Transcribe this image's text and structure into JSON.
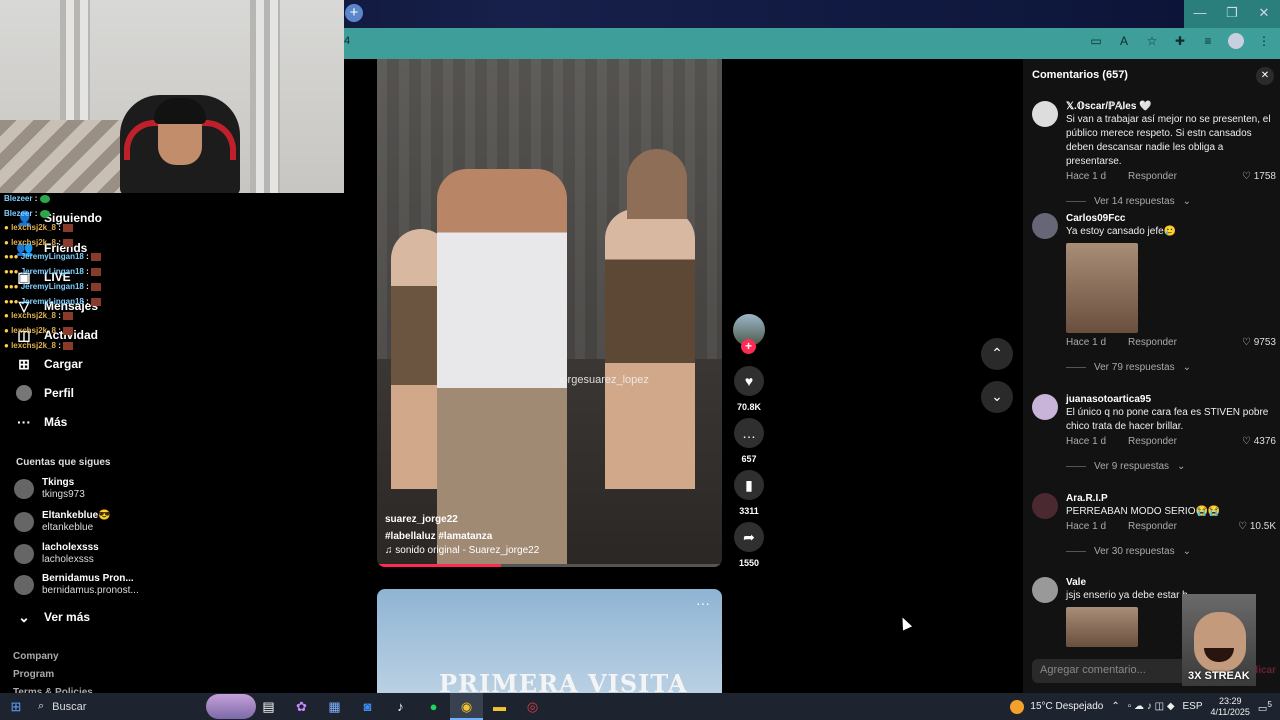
{
  "browser": {
    "url_fragment": "4",
    "new_tab": "+",
    "icons": [
      "screen-cast-icon",
      "translate-icon",
      "star-icon",
      "extensions-icon",
      "media-icon",
      "profile-icon",
      "menu-icon"
    ],
    "window_controls": [
      "—",
      "❐",
      "✕"
    ]
  },
  "chat": [
    {
      "user": "Blezeer",
      "msg": ""
    },
    {
      "user": "Blezeer",
      "msg": ""
    },
    {
      "user": "lexchsj2k_8",
      "msg": ""
    },
    {
      "user": "lexchsj2k_8",
      "msg": ""
    },
    {
      "user": "JeremyLingan18",
      "msg": ""
    },
    {
      "user": "JeremyLingan18",
      "msg": ""
    },
    {
      "user": "JeremyLingan18",
      "msg": ""
    },
    {
      "user": "JeremyLingan18",
      "msg": ""
    },
    {
      "user": "lexchsj2k_8",
      "msg": ""
    },
    {
      "user": "lexchsj2k_8",
      "msg": ""
    },
    {
      "user": "lexchsj2k_8",
      "msg": ""
    }
  ],
  "sidebar": {
    "items": [
      {
        "label": "Siguiendo"
      },
      {
        "label": "Friends"
      },
      {
        "label": "LIVE"
      },
      {
        "label": "Mensajes"
      },
      {
        "label": "Actividad"
      },
      {
        "label": "Cargar"
      },
      {
        "label": "Perfil"
      },
      {
        "label": "Más"
      }
    ],
    "following_title": "Cuentas que sigues",
    "following": [
      {
        "name": "Tkings",
        "handle": "tkings973"
      },
      {
        "name": "Eltankeblue😎",
        "handle": "eltankeblue"
      },
      {
        "name": "lacholexsss",
        "handle": "lacholexsss"
      },
      {
        "name": "Bernidamus Pron...",
        "handle": "bernidamus.pronost..."
      }
    ],
    "see_more": "Ver más",
    "footer": [
      "Company",
      "Program",
      "Terms & Policies"
    ]
  },
  "video": {
    "author": "suarez_jorge22",
    "hashtags": "#labellaluz  #lamatanza",
    "sound": "sonido original - Suarez_jorge22",
    "watermark": "jorgesuarez_lopez",
    "progress": 0.36,
    "likes": "70.8K",
    "comments": "657",
    "saves": "3311",
    "shares": "1550",
    "next_title": "PRIMERA VISITA"
  },
  "comments": {
    "header": "Comentarios (657)",
    "input_placeholder": "Agregar comentario...",
    "publish": "Publicar",
    "reply_label": "Responder",
    "items": [
      {
        "user": "𝕏.𝕆scar/ℙ𝔸les 🤍",
        "text": "Si van a trabajar así mejor no se presenten, el público merece respeto. Si estn cansados deben descansar nadie les obliga a presentarse.",
        "time": "Hace 1 d",
        "likes": "1758",
        "replies": "Ver 14 respuestas"
      },
      {
        "user": "Carlos09Fcc",
        "text": "Ya estoy cansado jefe🥲",
        "time": "Hace 1 d",
        "likes": "9753",
        "replies": "Ver 79 respuestas"
      },
      {
        "user": "juanasotoartica95",
        "text": "El único q no pone cara fea es STIVEN pobre chico trata de hacer brillar.",
        "time": "Hace 1 d",
        "likes": "4376",
        "replies": "Ver 9 respuestas"
      },
      {
        "user": "Ara.R.I.P",
        "text": "PERREABAN MODO SERIO😭😭",
        "time": "Hace 1 d",
        "likes": "10.5K",
        "replies": "Ver 30 respuestas"
      },
      {
        "user": "Vale",
        "text": "jsjs enserio ya debe estar b",
        "time": "",
        "likes": "",
        "replies": ""
      }
    ]
  },
  "streak": "3X STREAK",
  "taskbar": {
    "search": "Buscar",
    "weather": "15°C  Despejado",
    "lang": "ESP",
    "time": "23:29",
    "date": "4/11/2025",
    "notif": "5"
  },
  "colors": {
    "accent": "#fe2c55",
    "teal": "#3d9e9a"
  }
}
